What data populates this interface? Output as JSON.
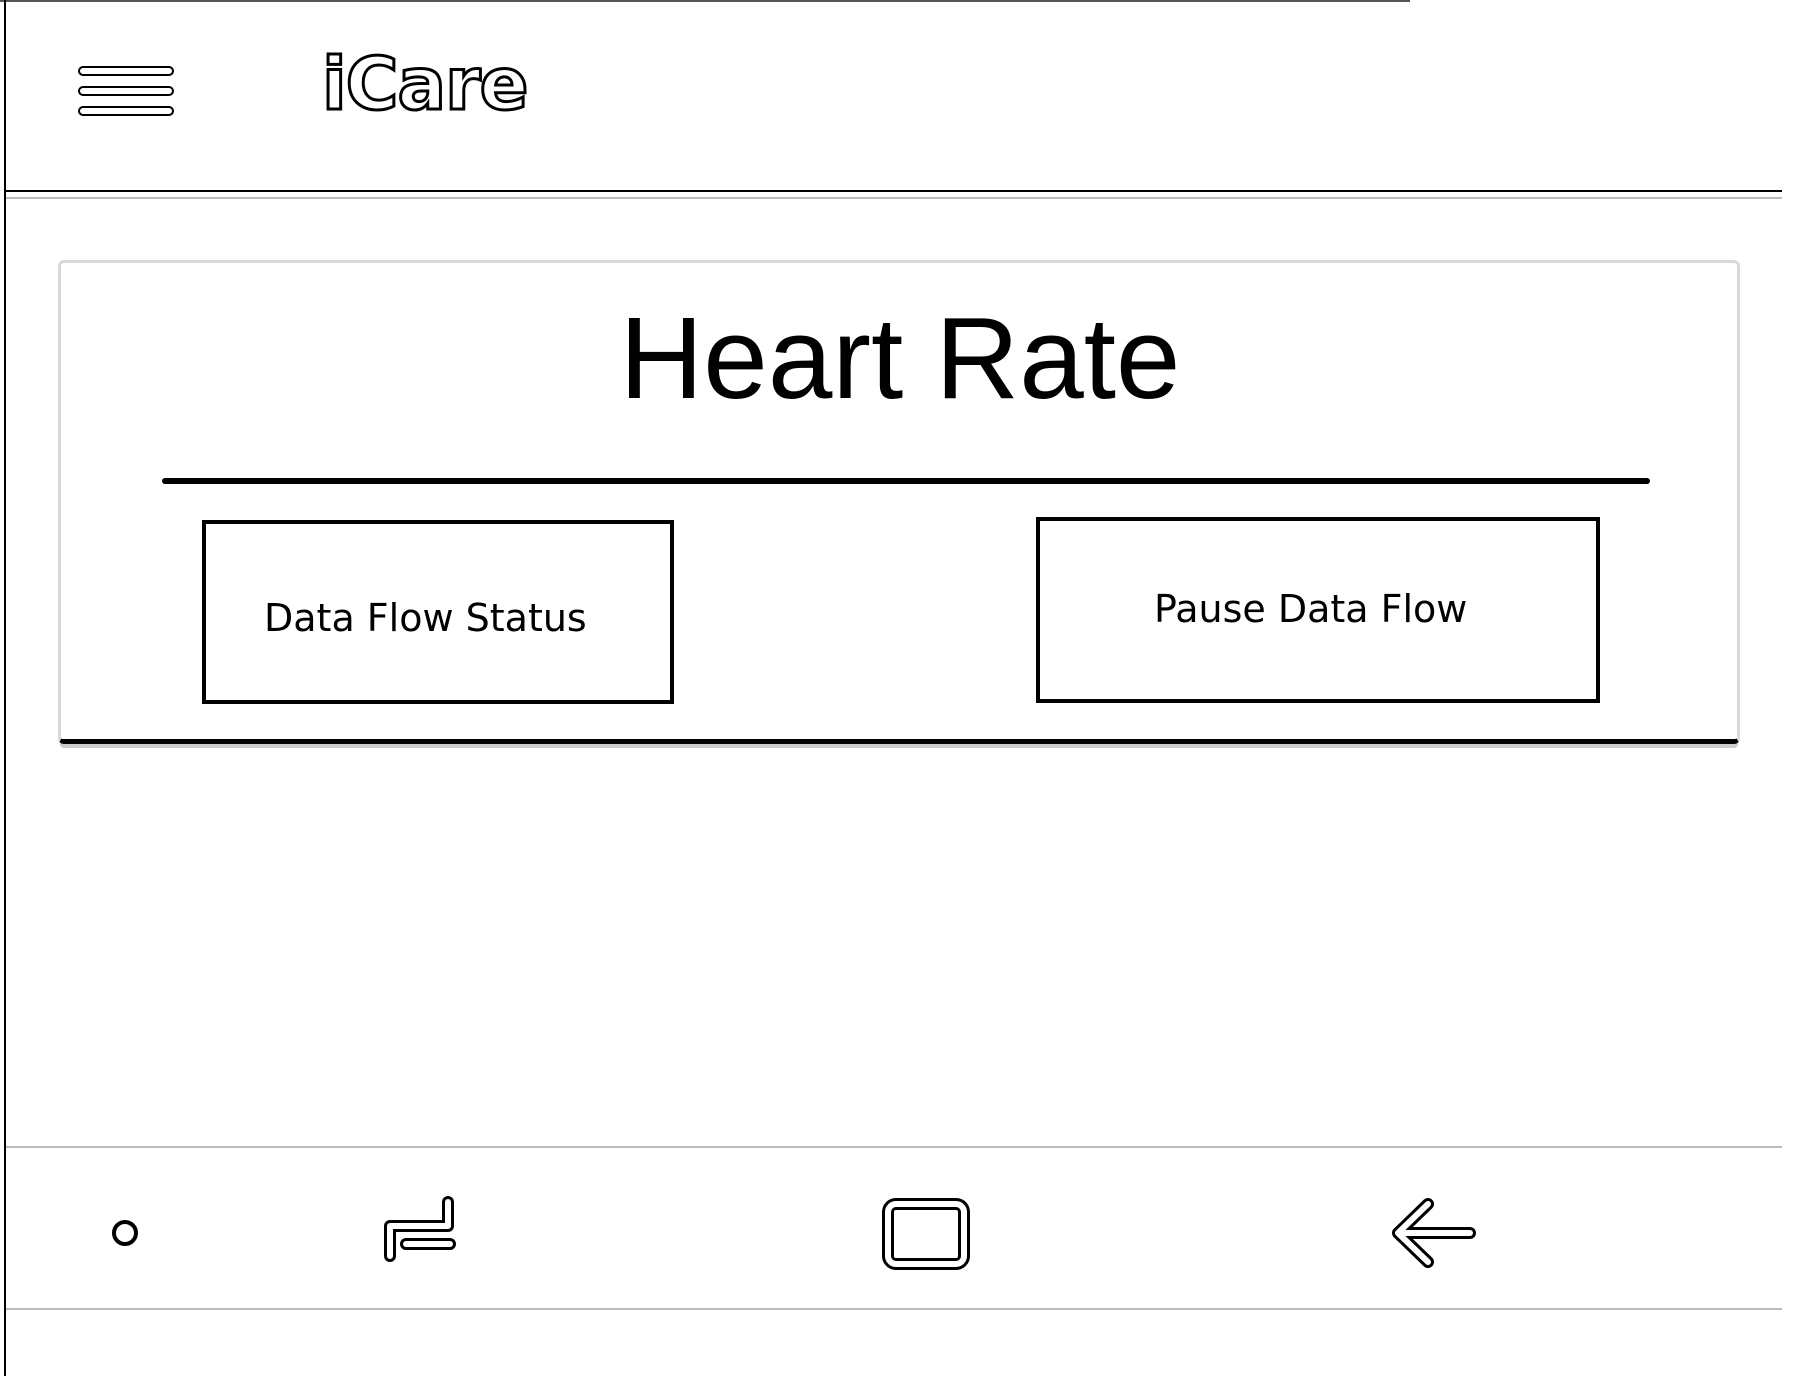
{
  "app_bar": {
    "title": "iCare",
    "menu_icon": "hamburger-menu-icon"
  },
  "card": {
    "title": "Heart Rate",
    "status_button_label": "Data Flow Status",
    "pause_button_label": "Pause Data Flow"
  },
  "nav_bar": {
    "icons": [
      "assistant-dot-icon",
      "recent-apps-icon",
      "home-square-icon",
      "back-arrow-icon"
    ]
  }
}
